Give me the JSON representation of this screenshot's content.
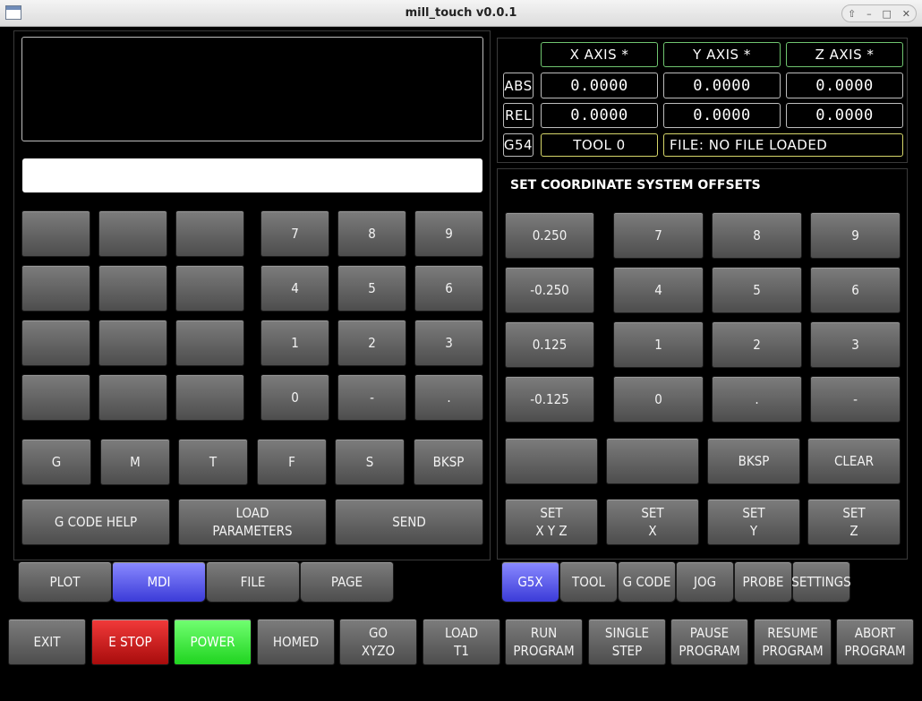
{
  "window": {
    "title": "mill_touch v0.0.1",
    "controls": [
      "⇧",
      "–",
      "□",
      "✕"
    ]
  },
  "mdi": {
    "keypad": [
      [
        "",
        "",
        "",
        "7",
        "8",
        "9"
      ],
      [
        "",
        "",
        "",
        "4",
        "5",
        "6"
      ],
      [
        "",
        "",
        "",
        "1",
        "2",
        "3"
      ],
      [
        "",
        "",
        "",
        "0",
        "-",
        "."
      ]
    ],
    "words": [
      "G",
      "M",
      "T",
      "F",
      "S",
      "BKSP"
    ],
    "actions": [
      "G CODE HELP",
      "LOAD\nPARAMETERS",
      "SEND"
    ]
  },
  "dro": {
    "axes": [
      "X AXIS *",
      "Y AXIS *",
      "Z AXIS *"
    ],
    "abs_label": "ABS",
    "rel_label": "REL",
    "wcs_label": "G54",
    "abs": [
      "0.0000",
      "0.0000",
      "0.0000"
    ],
    "rel": [
      "0.0000",
      "0.0000",
      "0.0000"
    ],
    "tool": "TOOL 0",
    "file": "FILE: NO FILE LOADED"
  },
  "offsets": {
    "title": "SET COORDINATE SYSTEM OFFSETS",
    "increments": [
      "0.250",
      "-0.250",
      "0.125",
      "-0.125"
    ],
    "keypad": [
      [
        "7",
        "8",
        "9"
      ],
      [
        "4",
        "5",
        "6"
      ],
      [
        "1",
        "2",
        "3"
      ],
      [
        "0",
        ".",
        "-"
      ]
    ],
    "edit": [
      "",
      "",
      "BKSP",
      "CLEAR"
    ],
    "set": [
      "SET\nX Y Z",
      "SET\nX",
      "SET\nY",
      "SET\nZ"
    ]
  },
  "left_tabs": {
    "items": [
      "PLOT",
      "MDI",
      "FILE",
      "PAGE"
    ],
    "active": 1
  },
  "right_tabs": {
    "items": [
      "G5X",
      "TOOL",
      "G CODE",
      "JOG",
      "PROBE",
      "SETTINGS"
    ],
    "active": 0
  },
  "bottom": [
    "EXIT",
    "E STOP",
    "POWER",
    "HOMED",
    "GO\nXYZO",
    "LOAD\nT1",
    "RUN\nPROGRAM",
    "SINGLE\nSTEP",
    "PAUSE\nPROGRAM",
    "RESUME\nPROGRAM",
    "ABORT\nPROGRAM"
  ],
  "colors": {
    "estop": "#d01818",
    "power": "#3ee83e",
    "active_tab": "#5a5af0"
  }
}
